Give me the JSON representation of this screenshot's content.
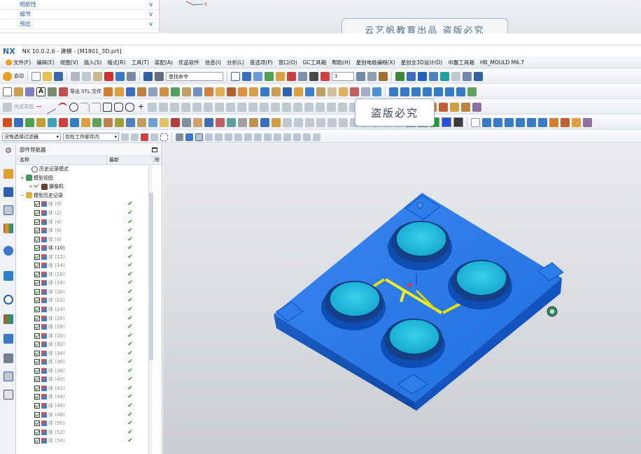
{
  "top_panel": {
    "items": [
      {
        "label": "相依性"
      },
      {
        "label": "细节"
      },
      {
        "label": "预览"
      }
    ],
    "banner_text": "云艺帆教育出品 盗版必究"
  },
  "window": {
    "logo": "NX",
    "title": "NX 10.0.2.6 - 建模 - [M1801_3D.prt]"
  },
  "menubar": {
    "items": [
      "文件(F)",
      "编辑(E)",
      "视图(V)",
      "插入(S)",
      "格式(R)",
      "工具(T)",
      "装配(A)",
      "优品软件",
      "信息(I)",
      "分析(L)",
      "首选项(P)",
      "窗口(O)",
      "GC工具箱",
      "帮助(H)",
      "星创电极编程(X)",
      "星创全3D设计(D)",
      "中磊工具箱",
      "HB_MOULD M6.7"
    ]
  },
  "toolbar1": {
    "start_label": "启动",
    "command_search_placeholder": "查找命令",
    "number_dropdown": "1"
  },
  "toolbar2": {
    "export_stl_label": "导出 STL 文件"
  },
  "toolbar3": {
    "sketch_label": "完成草图"
  },
  "filter_bar": {
    "selection_filter": "没有选择过滤器",
    "scope": "仅在工作部件内"
  },
  "watermark_popup": {
    "text": "盗版必究"
  },
  "colors": {
    "accent": "#2c6aa6",
    "part_blue": "#1f6fe0",
    "cavity_cyan": "#18b8d8",
    "check_green": "#1f9a1f"
  },
  "navigator": {
    "title": "部件导航器",
    "columns": [
      "名称",
      "最新",
      "附"
    ],
    "top_nodes": [
      {
        "label": "历史记录模式",
        "icon": "history-icon"
      },
      {
        "label": "模型视图",
        "icon": "model-views-icon"
      },
      {
        "label": "摄像机",
        "icon": "camera-icon"
      },
      {
        "label": "模型历史记录",
        "icon": "folder-icon"
      }
    ],
    "bodies": [
      {
        "label": "体 (0)",
        "dark": false
      },
      {
        "label": "体 (2)",
        "dark": false
      },
      {
        "label": "体 (4)",
        "dark": false
      },
      {
        "label": "体 (6)",
        "dark": false
      },
      {
        "label": "体 (8)",
        "dark": false
      },
      {
        "label": "体 (10)",
        "dark": true
      },
      {
        "label": "体 (12)",
        "dark": false
      },
      {
        "label": "体 (14)",
        "dark": false
      },
      {
        "label": "体 (16)",
        "dark": false
      },
      {
        "label": "体 (18)",
        "dark": false
      },
      {
        "label": "体 (20)",
        "dark": false
      },
      {
        "label": "体 (22)",
        "dark": false
      },
      {
        "label": "体 (24)",
        "dark": false
      },
      {
        "label": "体 (26)",
        "dark": false
      },
      {
        "label": "体 (28)",
        "dark": false
      },
      {
        "label": "体 (30)",
        "dark": false
      },
      {
        "label": "体 (32)",
        "dark": false
      },
      {
        "label": "体 (34)",
        "dark": false
      },
      {
        "label": "体 (36)",
        "dark": false
      },
      {
        "label": "体 (38)",
        "dark": false
      },
      {
        "label": "体 (40)",
        "dark": false
      },
      {
        "label": "体 (42)",
        "dark": false
      },
      {
        "label": "体 (44)",
        "dark": false
      },
      {
        "label": "体 (46)",
        "dark": false
      },
      {
        "label": "体 (48)",
        "dark": false
      },
      {
        "label": "体 (50)",
        "dark": false
      },
      {
        "label": "体 (52)",
        "dark": false
      },
      {
        "label": "体 (54)",
        "dark": false
      }
    ]
  }
}
